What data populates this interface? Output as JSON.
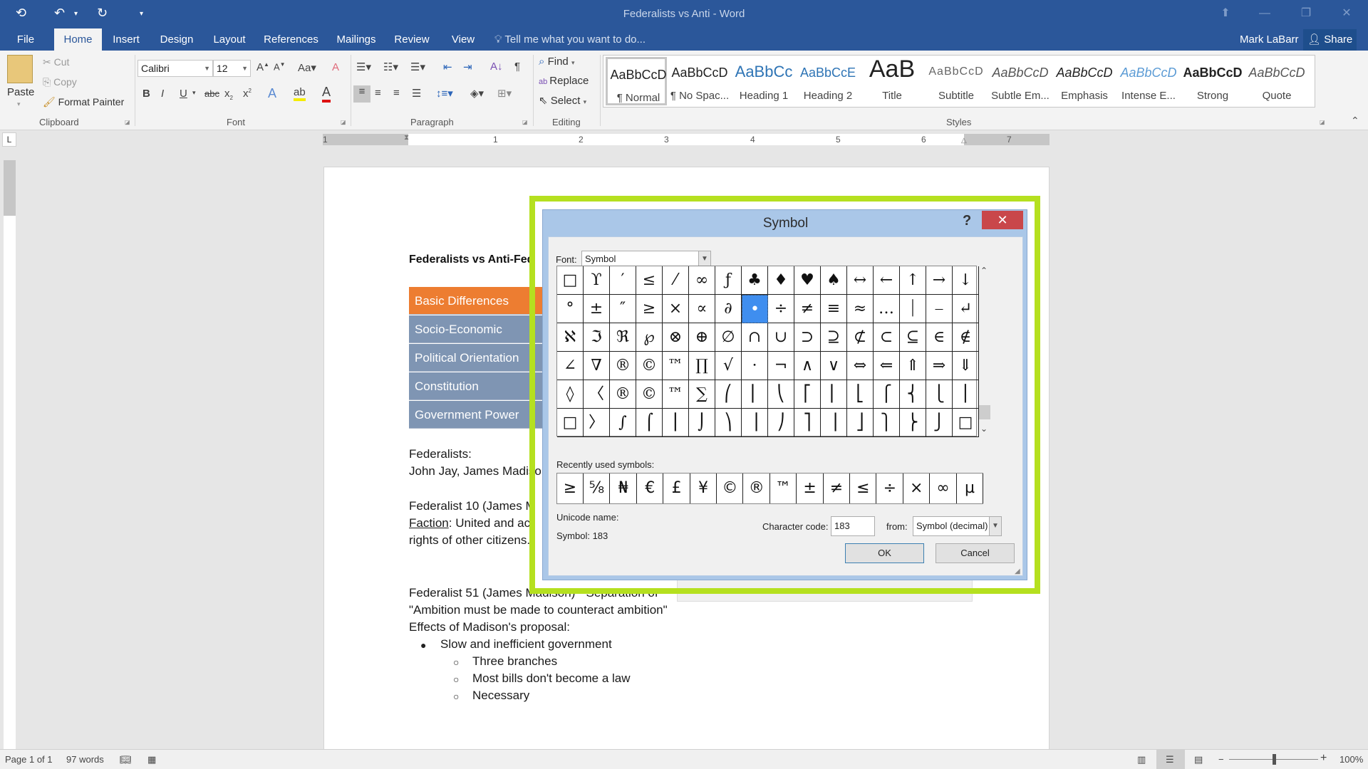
{
  "window": {
    "title": "Federalists vs Anti - Word",
    "user": "Mark LaBarr",
    "share_label": "Share",
    "tell_me_placeholder": "Tell me what you want to do..."
  },
  "tabs": [
    "File",
    "Home",
    "Insert",
    "Design",
    "Layout",
    "References",
    "Mailings",
    "Review",
    "View"
  ],
  "active_tab": "Home",
  "ribbon": {
    "clipboard": {
      "label": "Clipboard",
      "paste": "Paste",
      "cut": "Cut",
      "copy": "Copy",
      "format_painter": "Format Painter"
    },
    "font": {
      "label": "Font",
      "font_name": "Calibri",
      "font_size": "12"
    },
    "paragraph": {
      "label": "Paragraph"
    },
    "editing": {
      "label": "Editing",
      "find": "Find",
      "replace": "Replace",
      "select": "Select"
    },
    "styles": {
      "label": "Styles",
      "items": [
        {
          "preview": "AaBbCcD",
          "name": "¶ Normal"
        },
        {
          "preview": "AaBbCcD",
          "name": "¶ No Spac..."
        },
        {
          "preview": "AaBbCc",
          "name": "Heading 1"
        },
        {
          "preview": "AaBbCcE",
          "name": "Heading 2"
        },
        {
          "preview": "AaB",
          "name": "Title"
        },
        {
          "preview": "AaBbCcD",
          "name": "Subtitle"
        },
        {
          "preview": "AaBbCcD",
          "name": "Subtle Em..."
        },
        {
          "preview": "AaBbCcD",
          "name": "Emphasis"
        },
        {
          "preview": "AaBbCcD",
          "name": "Intense E..."
        },
        {
          "preview": "AaBbCcD",
          "name": "Strong"
        },
        {
          "preview": "AaBbCcD",
          "name": "Quote"
        }
      ]
    }
  },
  "ruler": {
    "numbers": [
      "1",
      "1",
      "2",
      "3",
      "4",
      "5",
      "6",
      "7"
    ],
    "tab_selector": "L"
  },
  "document": {
    "title": "Federalists vs Anti-Fed",
    "smartart": [
      "Basic Differences",
      "Socio-Economic",
      "Political Orientation",
      "Constitution",
      "Government Power"
    ],
    "lines": [
      "Federalists:",
      "John Jay, James Madiso",
      "Federalist 10 (James M",
      "Faction",
      ": United and act",
      "rights of other citizens.",
      "Federalist 51 (James Madison) - Separation of",
      "\"Ambition must be made to counteract ambition\"",
      "Effects of Madison's proposal:"
    ],
    "bullets": [
      {
        "level": 1,
        "text": "Slow and inefficient government"
      },
      {
        "level": 2,
        "text": "Three branches"
      },
      {
        "level": 2,
        "text": "Most bills don't become a law"
      },
      {
        "level": 2,
        "text": "Necessary"
      }
    ]
  },
  "dialog": {
    "title": "Symbol",
    "help": "?",
    "close": "✕",
    "font_label": "Font:",
    "font_value": "Symbol",
    "symbols": [
      [
        "□",
        "ϒ",
        "′",
        "≤",
        "⁄",
        "∞",
        "ƒ",
        "♣",
        "♦",
        "♥",
        "♠",
        "↔",
        "←",
        "↑",
        "→",
        "↓"
      ],
      [
        "°",
        "±",
        "″",
        "≥",
        "×",
        "∝",
        "∂",
        "•",
        "÷",
        "≠",
        "≡",
        "≈",
        "…",
        "⏐",
        "⎯",
        "↵"
      ],
      [
        "ℵ",
        "ℑ",
        "ℜ",
        "℘",
        "⊗",
        "⊕",
        "∅",
        "∩",
        "∪",
        "⊃",
        "⊇",
        "⊄",
        "⊂",
        "⊆",
        "∈",
        "∉"
      ],
      [
        "∠",
        "∇",
        "®",
        "©",
        "™",
        "∏",
        "√",
        "⋅",
        "¬",
        "∧",
        "∨",
        "⇔",
        "⇐",
        "⇑",
        "⇒",
        "⇓"
      ],
      [
        "◊",
        "〈",
        "®",
        "©",
        "™",
        "∑",
        "⎛",
        "⎜",
        "⎝",
        "⎡",
        "⎢",
        "⎣",
        "⎧",
        "⎨",
        "⎩",
        "⎪"
      ],
      [
        "□",
        "〉",
        "∫",
        "⌠",
        "⎮",
        "⌡",
        "⎞",
        "⎟",
        "⎠",
        "⎤",
        "⎥",
        "⎦",
        "⎫",
        "⎬",
        "⎭",
        "□"
      ]
    ],
    "selected_symbol": {
      "row": 1,
      "col": 7
    },
    "recent_label": "Recently used symbols:",
    "recent": [
      "≥",
      "⅝",
      "₦",
      "€",
      "£",
      "¥",
      "©",
      "®",
      "™",
      "±",
      "≠",
      "≤",
      "÷",
      "×",
      "∞",
      "µ"
    ],
    "unicode_name_label": "Unicode name:",
    "unicode_name_value": "Symbol: 183",
    "char_code_label": "Character code:",
    "char_code_value": "183",
    "from_label": "from:",
    "from_value": "Symbol (decimal)",
    "ok": "OK",
    "cancel": "Cancel"
  },
  "status": {
    "page": "Page 1 of 1",
    "words": "97 words",
    "zoom": "100%",
    "zoom_percent": 100
  },
  "colors": {
    "word_blue": "#2b579a",
    "highlight_green": "#b5e01f",
    "smartart_active": "#ed7d31",
    "smartart_item": "#7f95b3",
    "selected_cell": "#3f8eef",
    "close_red": "#c9474a"
  }
}
